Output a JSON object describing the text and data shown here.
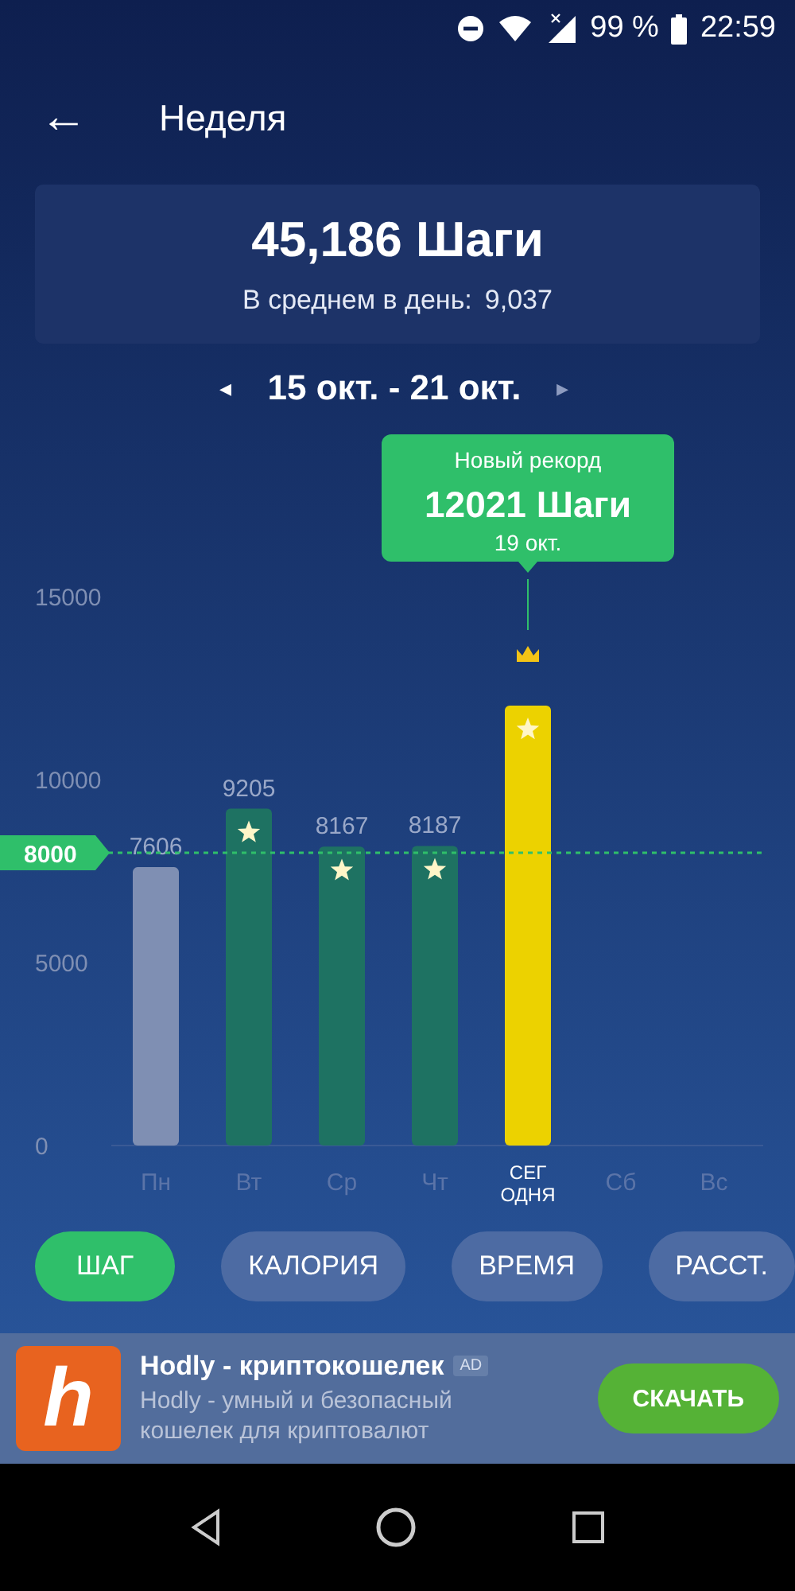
{
  "status_bar": {
    "battery": "99 %",
    "time": "22:59"
  },
  "header": {
    "back": "←",
    "title": "Неделя"
  },
  "summary": {
    "total": "45,186 Шаги",
    "average_label": "В среднем в день:",
    "average_value": "9,037"
  },
  "week_nav": {
    "prev": "◂",
    "range": "15 окт. - 21 окт.",
    "next": "▸"
  },
  "chart": {
    "goal_label": "8000",
    "record": {
      "title": "Новый рекорд",
      "value": "12021 Шаги",
      "date": "19 окт."
    },
    "bars": [
      {
        "color": "#7f8fb3"
      },
      {
        "color": "#1e7262"
      },
      {
        "color": "#1e7262"
      },
      {
        "color": "#1e7262"
      },
      {
        "color": "#ecd200"
      }
    ],
    "chart_data": {
      "type": "bar",
      "categories": [
        "Пн",
        "Вт",
        "Ср",
        "Чт",
        "СЕГ ОДНЯ",
        "Сб",
        "Вс"
      ],
      "values": [
        7606,
        9205,
        8167,
        8187,
        12021,
        null,
        null
      ],
      "ylim": [
        0,
        15000
      ],
      "yticks": [
        0,
        5000,
        10000,
        15000
      ],
      "value_labels": [
        "7606",
        "9205",
        "8167",
        "8187",
        null,
        null,
        null
      ]
    }
  },
  "metric_tabs": [
    {
      "label": "ШАГ",
      "selected": true
    },
    {
      "label": "КАЛОРИЯ",
      "selected": false
    },
    {
      "label": "ВРЕМЯ",
      "selected": false
    },
    {
      "label": "РАССТ.",
      "selected": false
    }
  ],
  "ad": {
    "logo_letter": "h",
    "title": "Hodly - криптокошелек",
    "badge": "AD",
    "text": "Hodly - умный и безопасный кошелек для криптовалют",
    "button": "СКАЧАТЬ"
  }
}
